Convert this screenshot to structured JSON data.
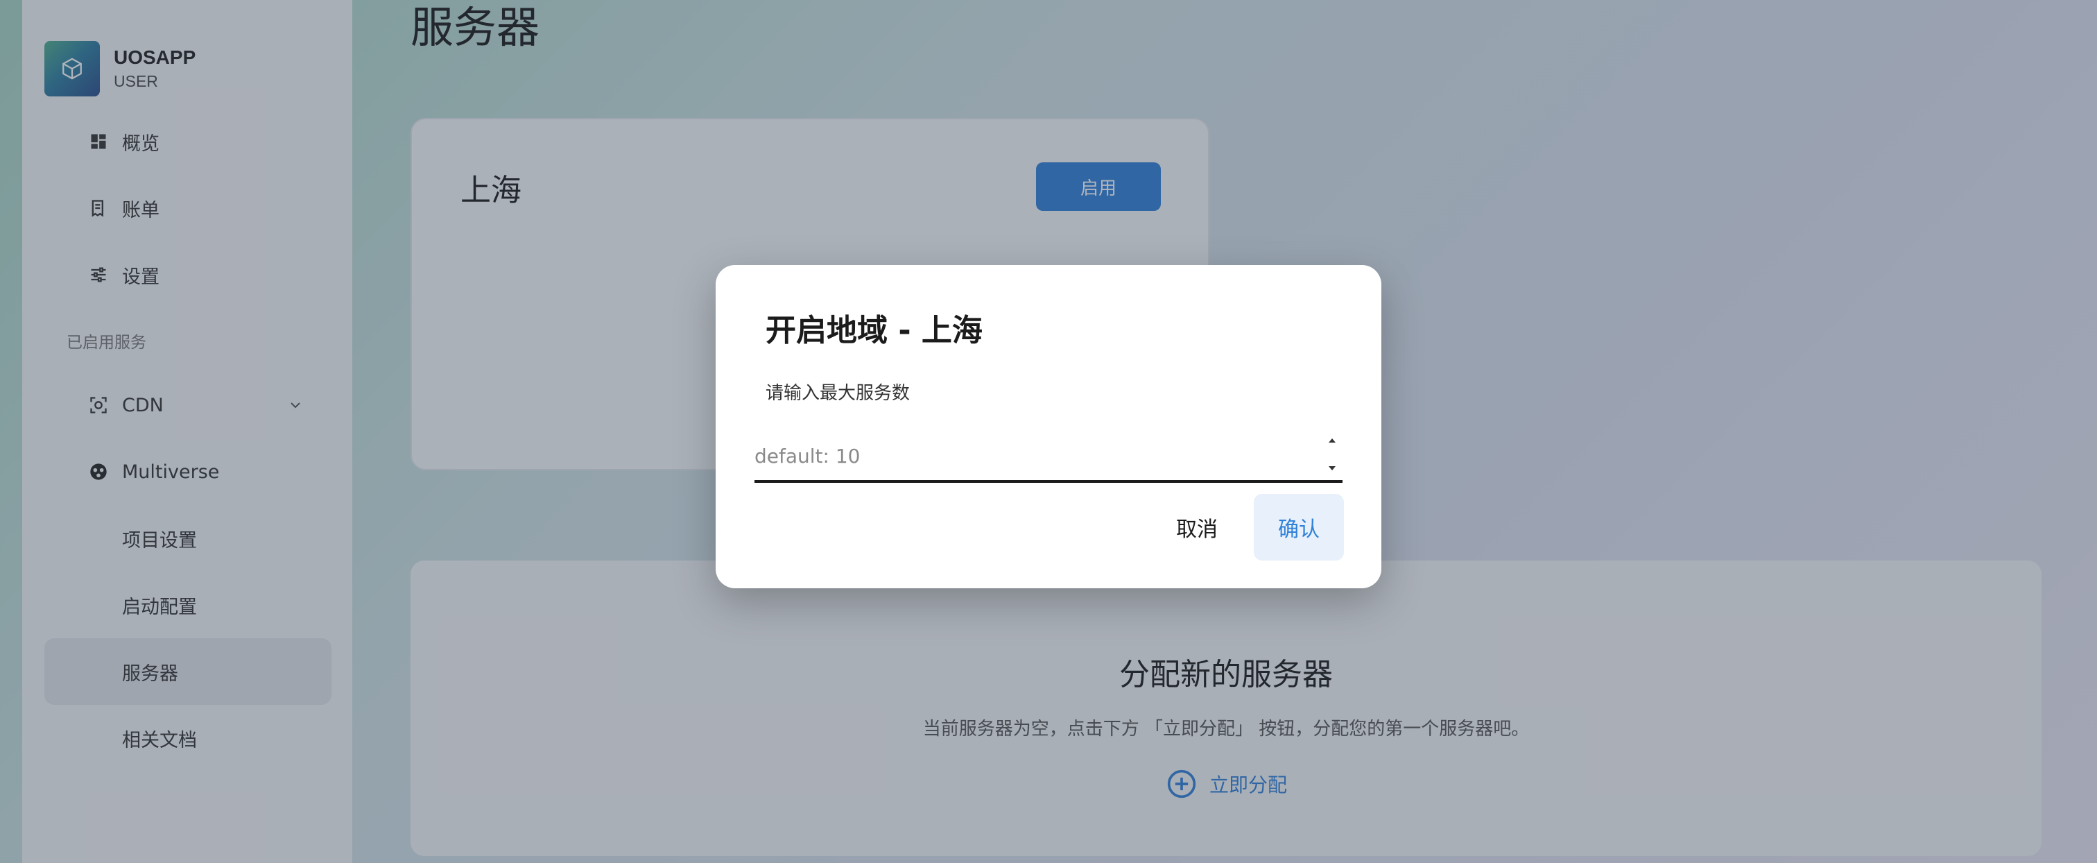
{
  "profile": {
    "name": "UOSAPP",
    "role": "USER"
  },
  "sidebar": {
    "items": [
      {
        "label": "概览",
        "icon": "dashboard-icon"
      },
      {
        "label": "账单",
        "icon": "bill-icon"
      },
      {
        "label": "设置",
        "icon": "sliders-icon"
      }
    ],
    "section_label": "已启用服务",
    "services": [
      {
        "label": "CDN",
        "icon": "cdn-icon",
        "expand_icon": "chevron-down-icon"
      },
      {
        "label": "Multiverse",
        "icon": "multiverse-icon"
      }
    ],
    "sub_items": [
      {
        "label": "项目设置"
      },
      {
        "label": "启动配置"
      },
      {
        "label": "服务器",
        "active": true
      },
      {
        "label": "相关文档"
      }
    ]
  },
  "main": {
    "page_title": "服务器",
    "region_card": {
      "name": "上海",
      "enable_label": "启用"
    },
    "alloc_card": {
      "title": "分配新的服务器",
      "description": "当前服务器为空，点击下方 「立即分配」 按钮，分配您的第一个服务器吧。",
      "action_label": "立即分配",
      "action_icon": "plus-circle-icon"
    }
  },
  "dialog": {
    "title": "开启地域 - 上海",
    "subtitle": "请输入最大服务数",
    "input_placeholder": "default: 10",
    "input_value": "",
    "cancel_label": "取消",
    "confirm_label": "确认"
  },
  "colors": {
    "accent": "#2f80d8",
    "confirm_bg": "#e7f0fb",
    "overlay": "rgba(50,60,80,0.38)"
  }
}
